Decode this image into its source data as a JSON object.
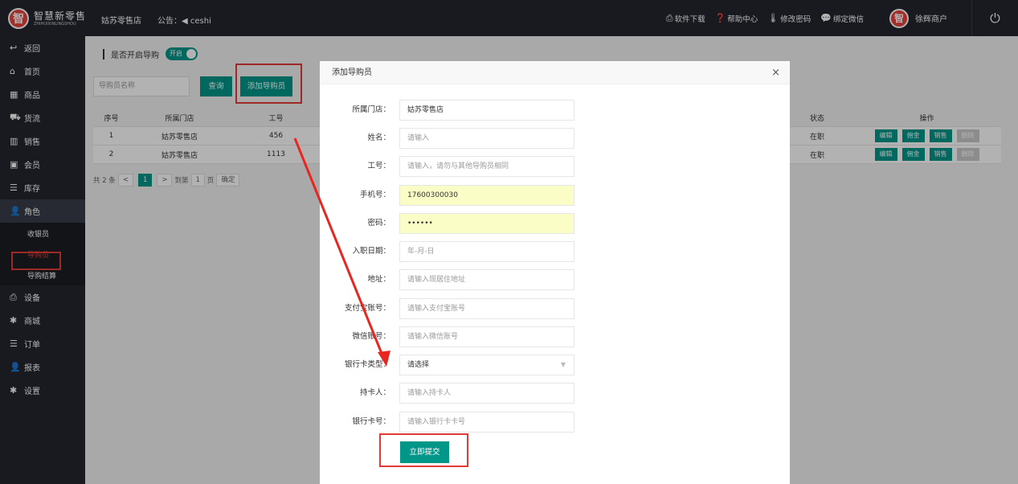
{
  "header": {
    "logo_mark": "智",
    "logo_cn": "智慧新零售",
    "logo_en": "ZHIHUIXINLINGSHOU",
    "store": "姑苏零售店",
    "notice_label": "公告：",
    "notice_icon": "speaker-icon",
    "notice_text": "ceshi",
    "links": [
      {
        "icon": "download-icon",
        "label": "软件下载"
      },
      {
        "icon": "help-icon",
        "label": "帮助中心"
      },
      {
        "icon": "key-icon",
        "label": "修改密码"
      },
      {
        "icon": "wechat-icon",
        "label": "绑定微信"
      }
    ],
    "user_name": "徐辉商户"
  },
  "sidebar": {
    "items": [
      {
        "icon": "back-icon",
        "label": "返回"
      },
      {
        "icon": "home-icon",
        "label": "首页"
      },
      {
        "icon": "grid-icon",
        "label": "商品"
      },
      {
        "icon": "truck-icon",
        "label": "货流"
      },
      {
        "icon": "chart-icon",
        "label": "销售"
      },
      {
        "icon": "member-icon",
        "label": "会员"
      },
      {
        "icon": "database-icon",
        "label": "库存"
      },
      {
        "icon": "user-icon",
        "label": "角色"
      }
    ],
    "sub_items": [
      {
        "label": "收银员"
      },
      {
        "label": "导购员"
      },
      {
        "label": "导购结算"
      }
    ],
    "items_after": [
      {
        "icon": "printer-icon",
        "label": "设备"
      },
      {
        "icon": "gear-icon",
        "label": "商城"
      },
      {
        "icon": "list-icon",
        "label": "订单"
      },
      {
        "icon": "user-icon",
        "label": "报表"
      },
      {
        "icon": "gear-icon",
        "label": "设置"
      }
    ]
  },
  "main": {
    "toggle_label": "是否开启导购",
    "toggle_state": "开启",
    "search_placeholder": "导购员名称",
    "search_button": "查询",
    "add_button": "添加导购员",
    "table": {
      "headers": [
        "序号",
        "所属门店",
        "工号",
        "状态",
        "操作"
      ],
      "rows": [
        {
          "no": "1",
          "store": "姑苏零售店",
          "code": "456",
          "status": "在职"
        },
        {
          "no": "2",
          "store": "姑苏零售店",
          "code": "1113",
          "status": "在职"
        }
      ],
      "actions": [
        "编辑",
        "佣金",
        "销售",
        "删除"
      ]
    },
    "pager": {
      "total": "共 2 条",
      "prev": "<",
      "current": "1",
      "next": ">",
      "goto_label": "到第",
      "goto_value": "1",
      "page_suffix": "页",
      "confirm": "确定"
    }
  },
  "modal": {
    "title": "添加导购员",
    "close": "×",
    "fields": [
      {
        "label": "所属门店：",
        "value": "姑苏零售店",
        "kind": "filled"
      },
      {
        "label": "姓名：",
        "value": "请输入",
        "kind": "placeholder"
      },
      {
        "label": "工号：",
        "value": "请输入，请勿与其他导购员相同",
        "kind": "placeholder"
      },
      {
        "label": "手机号：",
        "value": "17600300030",
        "kind": "auto"
      },
      {
        "label": "密码：",
        "value": "••••••",
        "kind": "auto"
      },
      {
        "label": "入职日期：",
        "value": "年-月-日",
        "kind": "placeholder"
      },
      {
        "label": "地址：",
        "value": "请输入现居住地址",
        "kind": "placeholder"
      },
      {
        "label": "支付宝账号：",
        "value": "请输入支付宝账号",
        "kind": "placeholder"
      },
      {
        "label": "微信账号：",
        "value": "请输入微信账号",
        "kind": "placeholder"
      },
      {
        "label": "银行卡类型：",
        "value": "请选择",
        "kind": "select"
      },
      {
        "label": "持卡人：",
        "value": "请输入持卡人",
        "kind": "placeholder"
      },
      {
        "label": "银行卡号：",
        "value": "请输入银行卡卡号",
        "kind": "placeholder"
      }
    ],
    "submit": "立即提交"
  },
  "colors": {
    "accent": "#009688",
    "dark": "#23262e",
    "highlight": "#e23b35",
    "autofill": "#fafdc6"
  }
}
